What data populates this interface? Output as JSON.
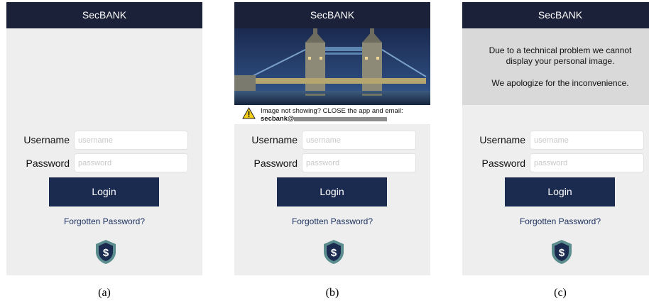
{
  "panels": [
    {
      "header": "SecBANK",
      "username_label": "Username",
      "username_placeholder": "username",
      "password_label": "Password",
      "password_placeholder": "password",
      "login_label": "Login",
      "forgot_label": "Forgotten Password?",
      "caption": "(a)"
    },
    {
      "header": "SecBANK",
      "warning_line1": "Image not showing? CLOSE the app and email:",
      "warning_email": "secbank@",
      "username_label": "Username",
      "username_placeholder": "username",
      "password_label": "Password",
      "password_placeholder": "password",
      "login_label": "Login",
      "forgot_label": "Forgotten Password?",
      "caption": "(b)"
    },
    {
      "header": "SecBANK",
      "message_line1": "Due to a technical problem we cannot",
      "message_line2": "display your personal image.",
      "message_line3": "We apologize for the inconvenience.",
      "username_label": "Username",
      "username_placeholder": "username",
      "password_label": "Password",
      "password_placeholder": "password",
      "login_label": "Login",
      "forgot_label": "Forgotten Password?",
      "caption": "(c)"
    }
  ],
  "icons": {
    "brand": "shield-dollar-icon",
    "warning": "warning-triangle-icon"
  },
  "colors": {
    "header_bg": "#1b2139",
    "login_bg": "#1b2b50",
    "link": "#1d3260",
    "panel_bg": "#eeeeee",
    "shield_outer": "#5b8d8f",
    "shield_inner": "#1b2b50"
  }
}
